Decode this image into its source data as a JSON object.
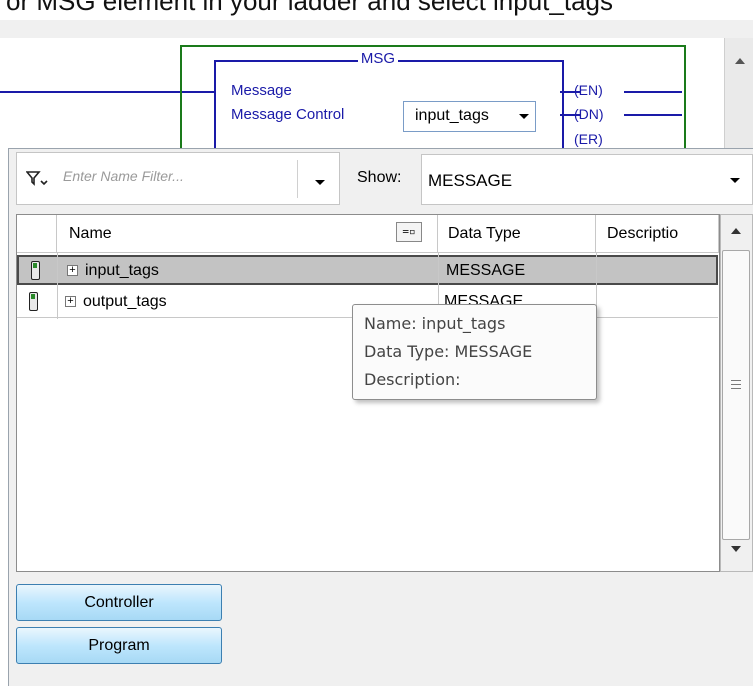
{
  "caption": {
    "text": "or MSG element in your ladder and select input_tags"
  },
  "ladder": {
    "instruction": "MSG",
    "type_label": "Message",
    "control_label": "Message Control",
    "control_value": "input_tags",
    "coils": [
      "(EN)",
      "(DN)",
      "(ER)"
    ],
    "rung_color": "#1a7a1a",
    "wire_color": "#1a1aa8"
  },
  "filter": {
    "placeholder": "Enter Name Filter...",
    "icon": "funnel-icon"
  },
  "show": {
    "label": "Show:",
    "value": "MESSAGE"
  },
  "grid": {
    "columns": [
      "Name",
      "Data Type",
      "Descriptio"
    ],
    "rows": [
      {
        "name": "input_tags",
        "type": "MESSAGE",
        "description": "",
        "selected": true
      },
      {
        "name": "output_tags",
        "type": "MESSAGE",
        "description": "",
        "selected": false
      }
    ]
  },
  "tooltip": {
    "name_line": "Name: input_tags",
    "type_line": "Data Type: MESSAGE",
    "desc_line": "Description:"
  },
  "buttons": {
    "controller": "Controller",
    "program": "Program"
  }
}
